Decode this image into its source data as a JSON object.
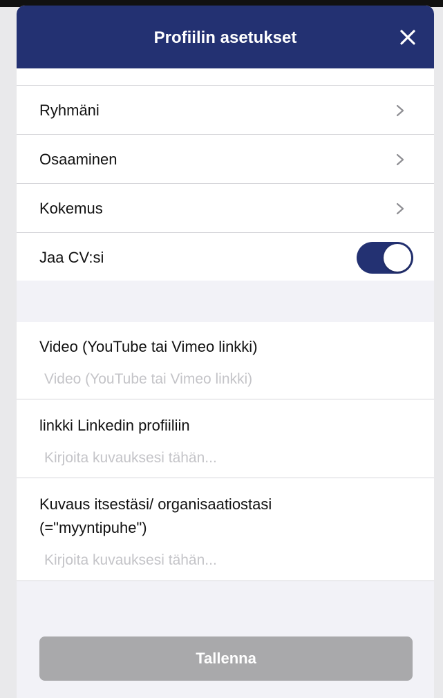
{
  "header": {
    "title": "Profiilin asetukset",
    "close_icon": "close-icon"
  },
  "settings": {
    "items": [
      {
        "label": "Ryhmäni",
        "icon": "chevron-right-icon"
      },
      {
        "label": "Osaaminen",
        "icon": "chevron-right-icon"
      },
      {
        "label": "Kokemus",
        "icon": "chevron-right-icon"
      }
    ],
    "share_cv": {
      "label": "Jaa CV:si",
      "enabled": true
    }
  },
  "form": {
    "video": {
      "label": "Video (YouTube tai Vimeo linkki)",
      "placeholder": "Video (YouTube tai Vimeo linkki)"
    },
    "linkedin": {
      "label": "linkki Linkedin profiiliin",
      "placeholder": "Kirjoita kuvauksesi tähän..."
    },
    "description": {
      "label_line1": "Kuvaus itsestäsi/ organisaatiostasi",
      "label_line2": "(=\"myyntipuhe\")",
      "placeholder": "Kirjoita kuvauksesi tähän..."
    }
  },
  "footer": {
    "save_label": "Tallenna"
  },
  "colors": {
    "brand": "#233172",
    "disabled_button": "#a9a9ab",
    "placeholder": "#c4c4c8"
  }
}
